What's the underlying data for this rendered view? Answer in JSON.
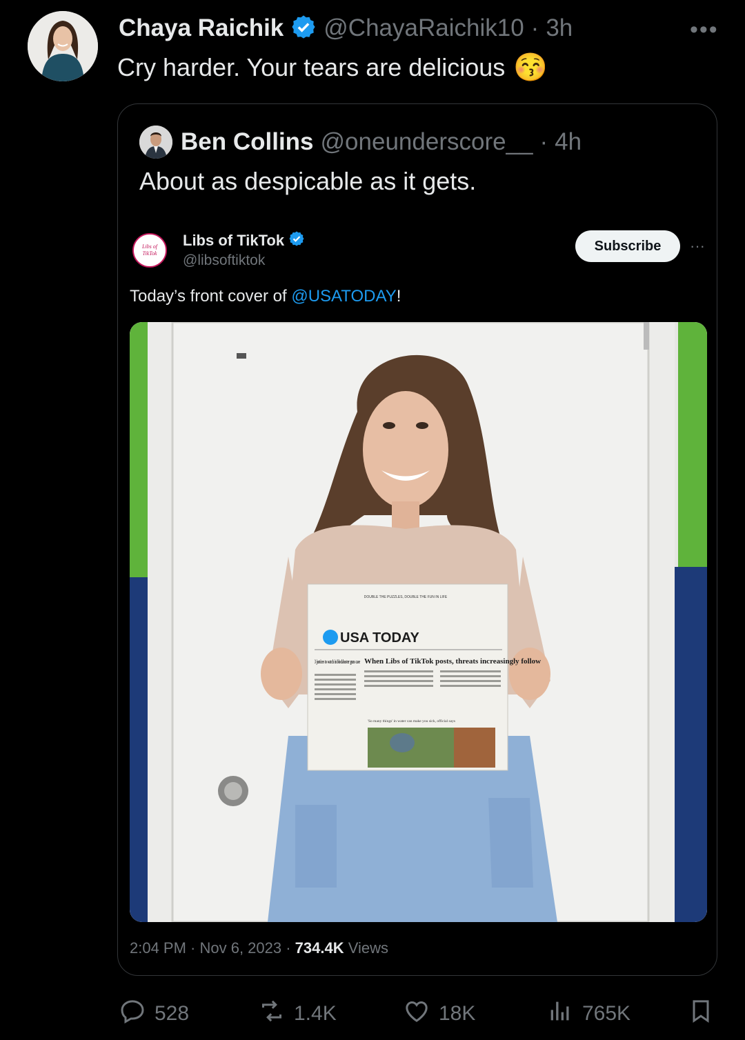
{
  "tweet": {
    "author_name": "Chaya Raichik",
    "author_handle": "@ChayaRaichik10",
    "separator": "·",
    "time": "3h",
    "more": "•••",
    "text": "Cry harder. Your tears are delicious",
    "emoji": "😚"
  },
  "quote": {
    "author_name": "Ben Collins",
    "author_handle": "@oneunderscore__",
    "separator": "·",
    "time": "4h",
    "text": "About as despicable as it gets."
  },
  "embedded": {
    "author_name": "Libs of TikTok",
    "author_handle": "@libsoftiktok",
    "avatar_text_1": "Libs of",
    "avatar_text_2": "TikTok",
    "subscribe_label": "Subscribe",
    "more": "···",
    "text_prefix": "Today’s front cover of ",
    "mention": "@USATODAY",
    "text_suffix": "!",
    "timestamp": "2:04 PM · Nov 6, 2023 · ",
    "views_count": "734.4K",
    "views_label": " Views"
  },
  "newspaper": {
    "masthead": "USA TODAY",
    "headline_main": "When Libs of TikTok posts, threats increasingly follow",
    "headline_side": "3 justices to watch in blockbuster guns case",
    "caption": "'So many things' in water can make you sick, official says",
    "top_banner": "DOUBLE THE PUZZLES, DOUBLE THE FUN IN LIFE"
  },
  "actions": {
    "replies": "528",
    "reposts": "1.4K",
    "likes": "18K",
    "views": "765K"
  },
  "colors": {
    "background": "#000000",
    "text": "#e7e9ea",
    "secondary": "#71767b",
    "accent": "#1d9bf0",
    "border": "#333639"
  },
  "icons": [
    "verified-badge-icon",
    "reply-icon",
    "repost-icon",
    "like-icon",
    "views-icon",
    "bookmark-icon"
  ]
}
